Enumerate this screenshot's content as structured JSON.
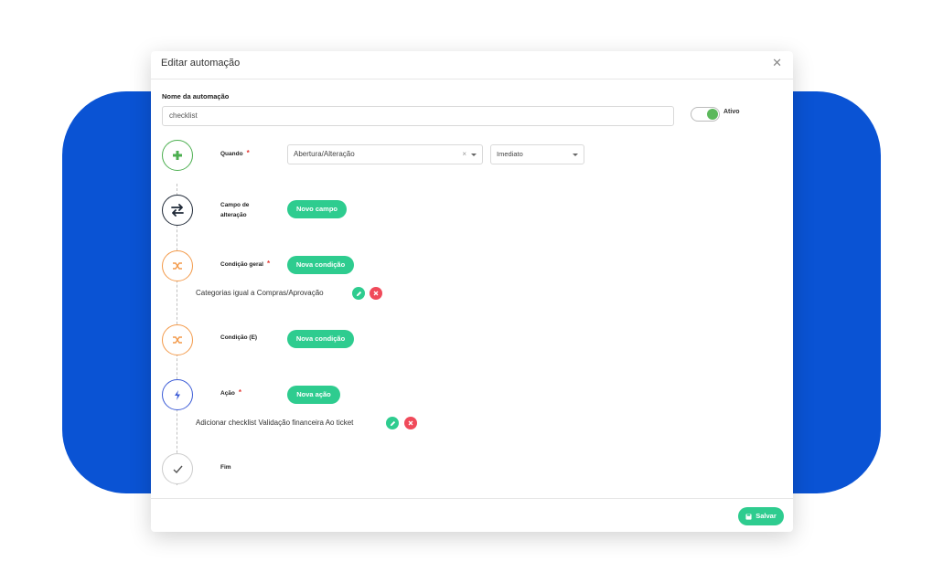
{
  "modal": {
    "title": "Editar automação",
    "close_icon": "close-icon"
  },
  "name_field": {
    "label": "Nome da automação",
    "value": "checklist"
  },
  "status_toggle": {
    "label": "Ativo",
    "on": true
  },
  "steps": {
    "quando": {
      "label": "Quando",
      "trigger_value": "Abertura/Alteração",
      "clear_symbol": "×",
      "timing_value": "Imediato"
    },
    "campo": {
      "label_line1": "Campo de",
      "label_line2": "alteração",
      "button": "Novo campo"
    },
    "condicao_geral": {
      "label": "Condição geral",
      "button": "Nova condição",
      "item": "Categorias igual a Compras/Aprovação"
    },
    "condicao_e": {
      "label": "Condição (E)",
      "button": "Nova condição"
    },
    "acao": {
      "label": "Ação",
      "button": "Nova ação",
      "item": "Adicionar checklist Validação financeira Ao ticket"
    },
    "fim": {
      "label": "Fim"
    }
  },
  "required_marker": "*",
  "footer": {
    "save_label": "Salvar"
  },
  "colors": {
    "brand_blue": "#0a53d4",
    "accent_green": "#2ecc8f",
    "danger_red": "#f04a5a",
    "step_plus": "#4caf50",
    "step_orange": "#f39a4a",
    "step_action": "#3b5bd6",
    "step_dark": "#1f2937"
  }
}
